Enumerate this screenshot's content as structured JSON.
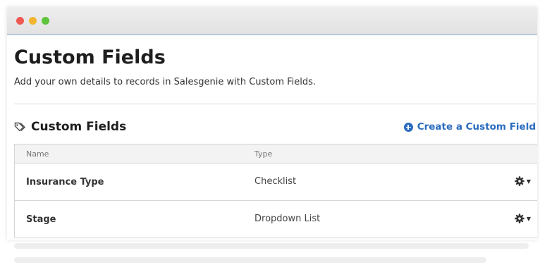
{
  "page": {
    "title": "Custom Fields",
    "description": "Add your own details to records in Salesgenie with Custom Fields."
  },
  "section": {
    "title": "Custom Fields",
    "create_link": "Create a Custom Field"
  },
  "table": {
    "columns": [
      "Name",
      "Type"
    ],
    "rows": [
      {
        "name": "Insurance Type",
        "type": "Checklist"
      },
      {
        "name": "Stage",
        "type": "Dropdown List"
      }
    ]
  },
  "colors": {
    "accent": "#2a6cbf",
    "window_close": "#ee5a52",
    "window_minimize": "#f2b52e",
    "window_maximize": "#5ec43c"
  },
  "icons": [
    "tags-icon",
    "plus-circle-icon",
    "gear-icon",
    "caret-down-icon"
  ]
}
